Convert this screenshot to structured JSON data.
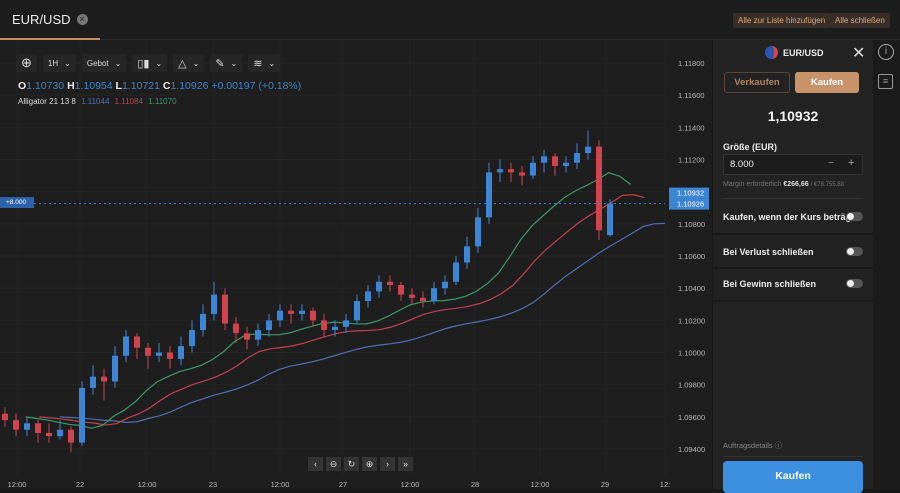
{
  "tab": {
    "title": "EUR/USD"
  },
  "top_actions": {
    "add_all": "Alle zur Liste hinzufügen",
    "close_all": "Alle schließen"
  },
  "toolbar": {
    "timeframe": "1H",
    "price_type": "Gebot"
  },
  "legend": {
    "o_label": "O",
    "o": "1.10730",
    "h_label": "H",
    "h": "1.10954",
    "l_label": "L",
    "l": "1.10721",
    "c_label": "C",
    "c": "1.10926",
    "change": "+0.00197 (+0.18%)"
  },
  "indicator": {
    "name": "Alligator 21 13 8",
    "jaw": "1.11044",
    "teeth": "1.11084",
    "lips": "1.11070",
    "colors": {
      "jaw": "#4f6fb0",
      "teeth": "#c0434f",
      "lips": "#3c9a68"
    }
  },
  "position_label": "+8.000",
  "nav_buttons": [
    "‹",
    "⊖",
    "↻",
    "⊕",
    "›",
    "»"
  ],
  "chart_data": {
    "type": "candlestick",
    "ylim": [
      1.0932,
      1.119
    ],
    "y_ticks": [
      "1.11800",
      "1.11600",
      "1.11400",
      "1.11200",
      "1.11000",
      "1.10800",
      "1.10600",
      "1.10400",
      "1.10200",
      "1.10000",
      "1.09800",
      "1.09600",
      "1.09400"
    ],
    "x_ticks": [
      "12:00",
      "22",
      "12:00",
      "23",
      "12:00",
      "27",
      "12:00",
      "28",
      "12:00",
      "29",
      "12:"
    ],
    "price_labels": {
      "ask": "1.10932",
      "bid": "1.10926"
    },
    "colors": {
      "up": "#3d86d6",
      "down": "#d0434f"
    },
    "ohlc": [
      [
        1.0962,
        1.0966,
        1.0954,
        1.0958
      ],
      [
        1.0958,
        1.0962,
        1.0948,
        1.0952
      ],
      [
        1.0952,
        1.096,
        1.0948,
        1.0956
      ],
      [
        1.0956,
        1.0958,
        1.0944,
        1.095
      ],
      [
        1.095,
        1.0956,
        1.0944,
        1.0948
      ],
      [
        1.0948,
        1.0958,
        1.0946,
        1.0952
      ],
      [
        1.0952,
        1.0954,
        1.0938,
        1.0944
      ],
      [
        1.0944,
        1.0982,
        1.0942,
        1.0978
      ],
      [
        1.0978,
        1.0992,
        1.0974,
        1.0985
      ],
      [
        1.0985,
        1.099,
        1.097,
        1.0982
      ],
      [
        1.0982,
        1.1004,
        1.0978,
        1.0998
      ],
      [
        1.0998,
        1.1014,
        1.0994,
        1.101
      ],
      [
        1.101,
        1.1012,
        1.0996,
        1.1003
      ],
      [
        1.1003,
        1.1006,
        1.099,
        1.0998
      ],
      [
        1.0998,
        1.1006,
        1.0994,
        1.1
      ],
      [
        1.1,
        1.1004,
        1.099,
        1.0996
      ],
      [
        1.0996,
        1.101,
        1.0992,
        1.1004
      ],
      [
        1.1004,
        1.102,
        1.1,
        1.1014
      ],
      [
        1.1014,
        1.103,
        1.101,
        1.1024
      ],
      [
        1.1024,
        1.1044,
        1.102,
        1.1036
      ],
      [
        1.1036,
        1.104,
        1.1014,
        1.1018
      ],
      [
        1.1018,
        1.1022,
        1.1006,
        1.1012
      ],
      [
        1.1012,
        1.1016,
        1.1002,
        1.1008
      ],
      [
        1.1008,
        1.1018,
        1.1004,
        1.1014
      ],
      [
        1.1014,
        1.1024,
        1.101,
        1.102
      ],
      [
        1.102,
        1.103,
        1.1016,
        1.1026
      ],
      [
        1.1026,
        1.103,
        1.1018,
        1.1024
      ],
      [
        1.1024,
        1.103,
        1.102,
        1.1026
      ],
      [
        1.1026,
        1.1028,
        1.1016,
        1.102
      ],
      [
        1.102,
        1.1024,
        1.101,
        1.1014
      ],
      [
        1.1014,
        1.102,
        1.101,
        1.1016
      ],
      [
        1.1016,
        1.1024,
        1.1012,
        1.102
      ],
      [
        1.102,
        1.1036,
        1.1018,
        1.1032
      ],
      [
        1.1032,
        1.1042,
        1.1028,
        1.1038
      ],
      [
        1.1038,
        1.1048,
        1.1034,
        1.1044
      ],
      [
        1.1044,
        1.1048,
        1.1038,
        1.1042
      ],
      [
        1.1042,
        1.1044,
        1.1032,
        1.1036
      ],
      [
        1.1036,
        1.104,
        1.103,
        1.1034
      ],
      [
        1.1034,
        1.1038,
        1.1028,
        1.1032
      ],
      [
        1.1032,
        1.1044,
        1.103,
        1.104
      ],
      [
        1.104,
        1.1048,
        1.1036,
        1.1044
      ],
      [
        1.1044,
        1.106,
        1.1042,
        1.1056
      ],
      [
        1.1056,
        1.1072,
        1.1052,
        1.1066
      ],
      [
        1.1066,
        1.109,
        1.1062,
        1.1084
      ],
      [
        1.1084,
        1.1118,
        1.108,
        1.1112
      ],
      [
        1.1112,
        1.112,
        1.1106,
        1.1114
      ],
      [
        1.1114,
        1.1118,
        1.1106,
        1.1112
      ],
      [
        1.1112,
        1.1116,
        1.1104,
        1.111
      ],
      [
        1.111,
        1.1122,
        1.1108,
        1.1118
      ],
      [
        1.1118,
        1.1126,
        1.1112,
        1.1122
      ],
      [
        1.1122,
        1.1124,
        1.111,
        1.1116
      ],
      [
        1.1116,
        1.1122,
        1.1112,
        1.1118
      ],
      [
        1.1118,
        1.113,
        1.1114,
        1.1124
      ],
      [
        1.1124,
        1.1138,
        1.112,
        1.1128
      ],
      [
        1.1128,
        1.1132,
        1.107,
        1.1076
      ],
      [
        1.1073,
        1.10954,
        1.10721,
        1.10926
      ]
    ]
  },
  "order_panel": {
    "symbol": "EUR/USD",
    "sell": "Verkaufen",
    "buy": "Kaufen",
    "price": "1,10932",
    "size_label": "Größe (EUR)",
    "size_value": "8.000",
    "minus": "−",
    "plus": "+",
    "margin_label": "Margin erforderlich",
    "margin_value": "€266,66",
    "margin_available": "/ €78.755,88",
    "limit_label": "Kaufen, wenn der Kurs beträgt",
    "stop_loss_label": "Bei Verlust schließen",
    "take_profit_label": "Bei Gewinn schließen",
    "details_label": "Auftragsdetails",
    "submit": "Kaufen"
  },
  "accent": "#c98f5f",
  "buy_color": "#3d8fe0"
}
